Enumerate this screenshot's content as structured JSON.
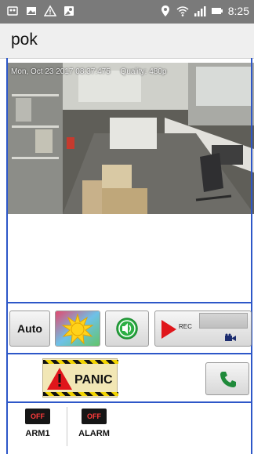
{
  "status_bar": {
    "time": "8:25",
    "left_icons": [
      "sim-icon",
      "image-icon",
      "warning-icon",
      "gallery-icon"
    ],
    "right_icons": [
      "location-icon",
      "wifi-icon",
      "signal-icon",
      "battery-icon"
    ]
  },
  "app": {
    "title": "pok"
  },
  "camera": {
    "timestamp": "Mon, Oct 23 2017 08:37:475",
    "quality": "Quality: 480p"
  },
  "controls": {
    "auto_label": "Auto",
    "brightness_icon": "sun-icon",
    "sound_icon": "speaker-icon",
    "rec_label": "REC",
    "camcorder_icon": "video-camera-icon"
  },
  "actions": {
    "panic_label": "PANIC",
    "call_icon": "phone-icon"
  },
  "statuses": [
    {
      "state": "OFF",
      "label": "ARM1"
    },
    {
      "state": "OFF",
      "label": "ALARM"
    }
  ],
  "colors": {
    "accent_border": "#2d57c8",
    "status_bar": "#7a7a7a",
    "rec_red": "#e0161b",
    "sound_green": "#22a33a",
    "call_green": "#1f8a3a",
    "off_red": "#ff3b3b"
  }
}
